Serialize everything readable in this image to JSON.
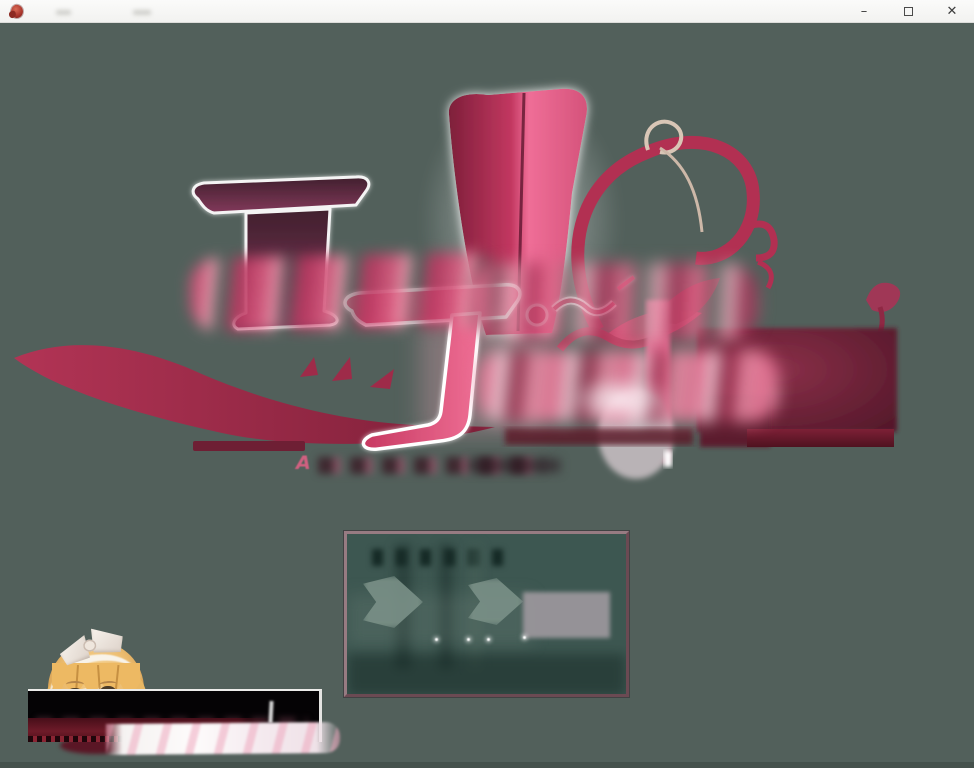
{
  "window": {
    "title_text": "",
    "controls": {
      "minimize_glyph": "–",
      "close_glyph": "✕"
    }
  },
  "titlebar": {
    "app_icon": "red-crest-icon",
    "title_state": "blurred-illegible"
  },
  "screen": {
    "subtitle_visible_char": "A",
    "redacted_regions": [
      "window-title",
      "logo-title-text",
      "logo-subtitle-text",
      "menu-item-labels",
      "dialog-text"
    ]
  },
  "menu_panel": {
    "items_state": "blurred-illegible",
    "item_marker": "arrow-heart-shape"
  },
  "character": {
    "hair_accessory": "white-bow",
    "eye_color_name": "green"
  },
  "colors": {
    "titlebar_bg": "#f7f7f5",
    "desktop_bg": "#52605b",
    "logo_pink": "#e0476f",
    "logo_crimson": "#a82c4c",
    "logo_maroon": "#5d1f34",
    "menu_border": "#8d7179",
    "menu_bg": "#3d5751",
    "dialog_bg": "#050305",
    "ribbon_red": "#6e1b29",
    "ribbon_white": "#fdfbfb",
    "hair": "#e7b261",
    "eyes": "#5d7a35"
  }
}
